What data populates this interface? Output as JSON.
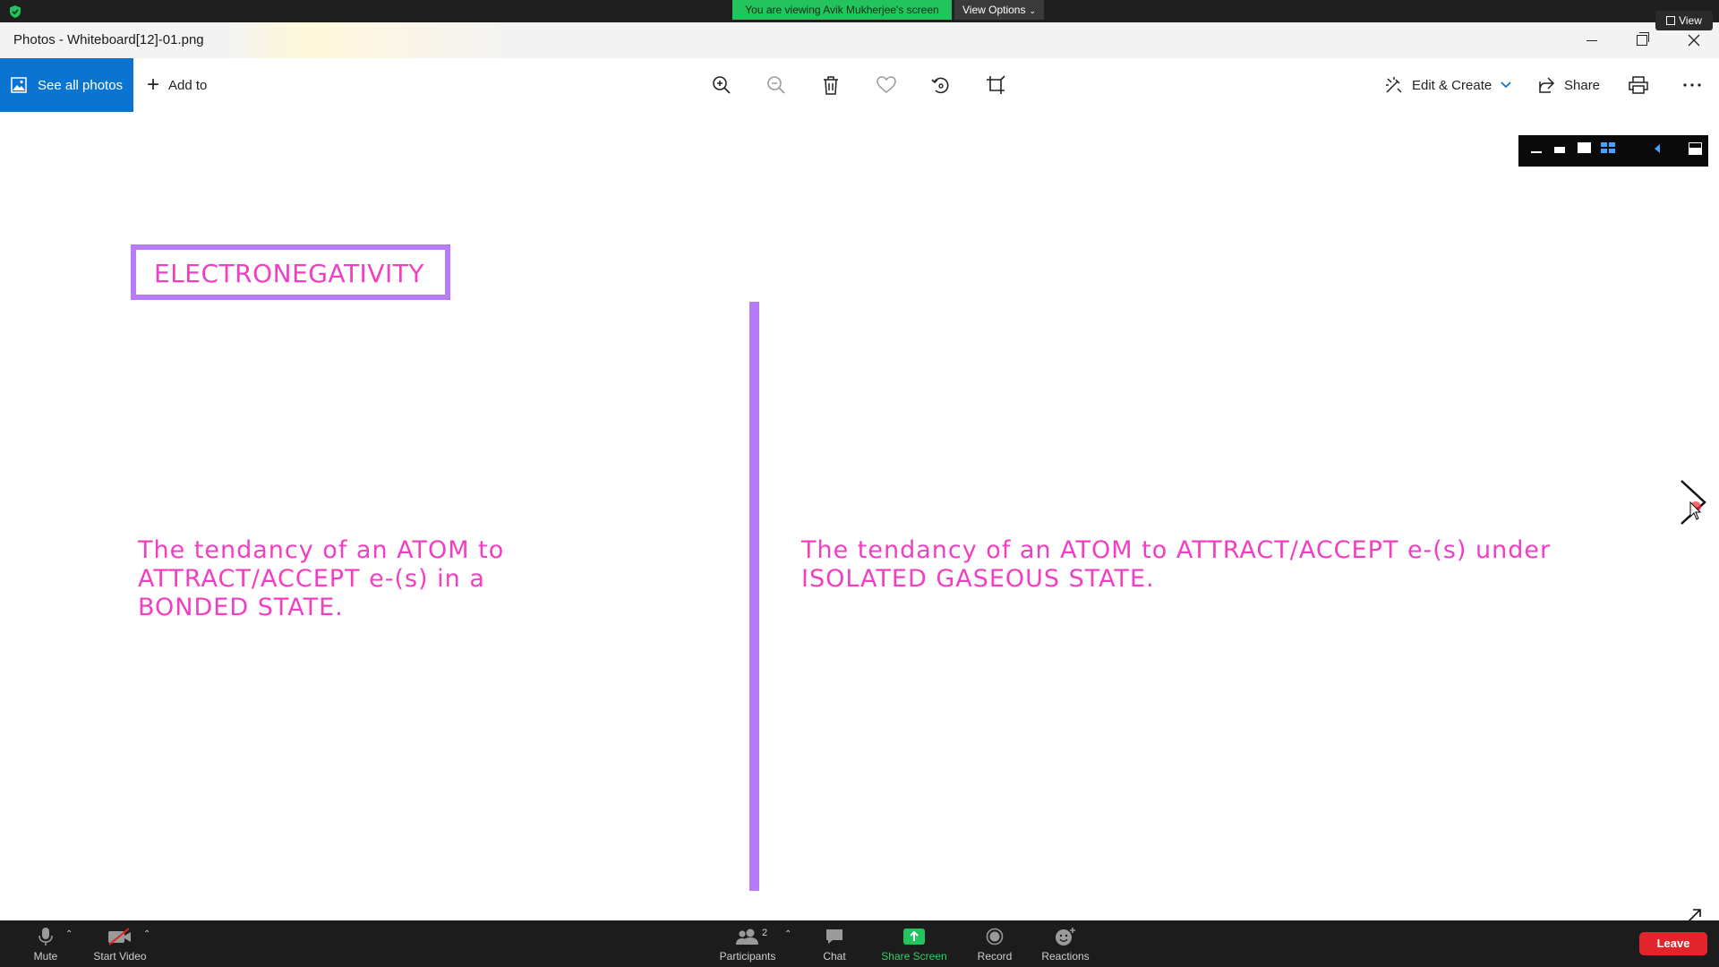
{
  "zoom_top": {
    "banner_text": "You are viewing Avik Mukherjee's screen",
    "view_options_label": "View Options",
    "view_label": "View",
    "banner_color": "#23c45e"
  },
  "photos": {
    "window_title": "Photos - Whiteboard[12]-01.png",
    "see_all_photos_label": "See all photos",
    "add_to_label": "Add to",
    "edit_create_label": "Edit & Create",
    "share_label": "Share",
    "accent_color": "#0b74d1",
    "toolbar_icons": [
      "zoom-in-icon",
      "zoom-out-icon",
      "delete-icon",
      "favorite-icon",
      "rotate-icon",
      "crop-icon",
      "print-icon",
      "more-icon"
    ]
  },
  "whiteboard": {
    "heading": "ELECTRONEGATIVITY",
    "left_definition": "The tendancy of an ATOM to ATTRACT/ACCEPT e-(s) in a BONDED STATE.",
    "right_definition_line1": "The tendancy of an ATOM to ATTRACT/ACCEPT e-(s) under",
    "right_definition_line2": "ISOLATED GASEOUS STATE.",
    "text_color": "#f23ec2",
    "frame_color": "#b57cf5"
  },
  "zoom_bottom": {
    "mute_label": "Mute",
    "start_video_label": "Start Video",
    "participants_label": "Participants",
    "participants_count": "2",
    "chat_label": "Chat",
    "share_screen_label": "Share Screen",
    "record_label": "Record",
    "reactions_label": "Reactions",
    "leave_label": "Leave",
    "leave_color": "#e0262c"
  }
}
